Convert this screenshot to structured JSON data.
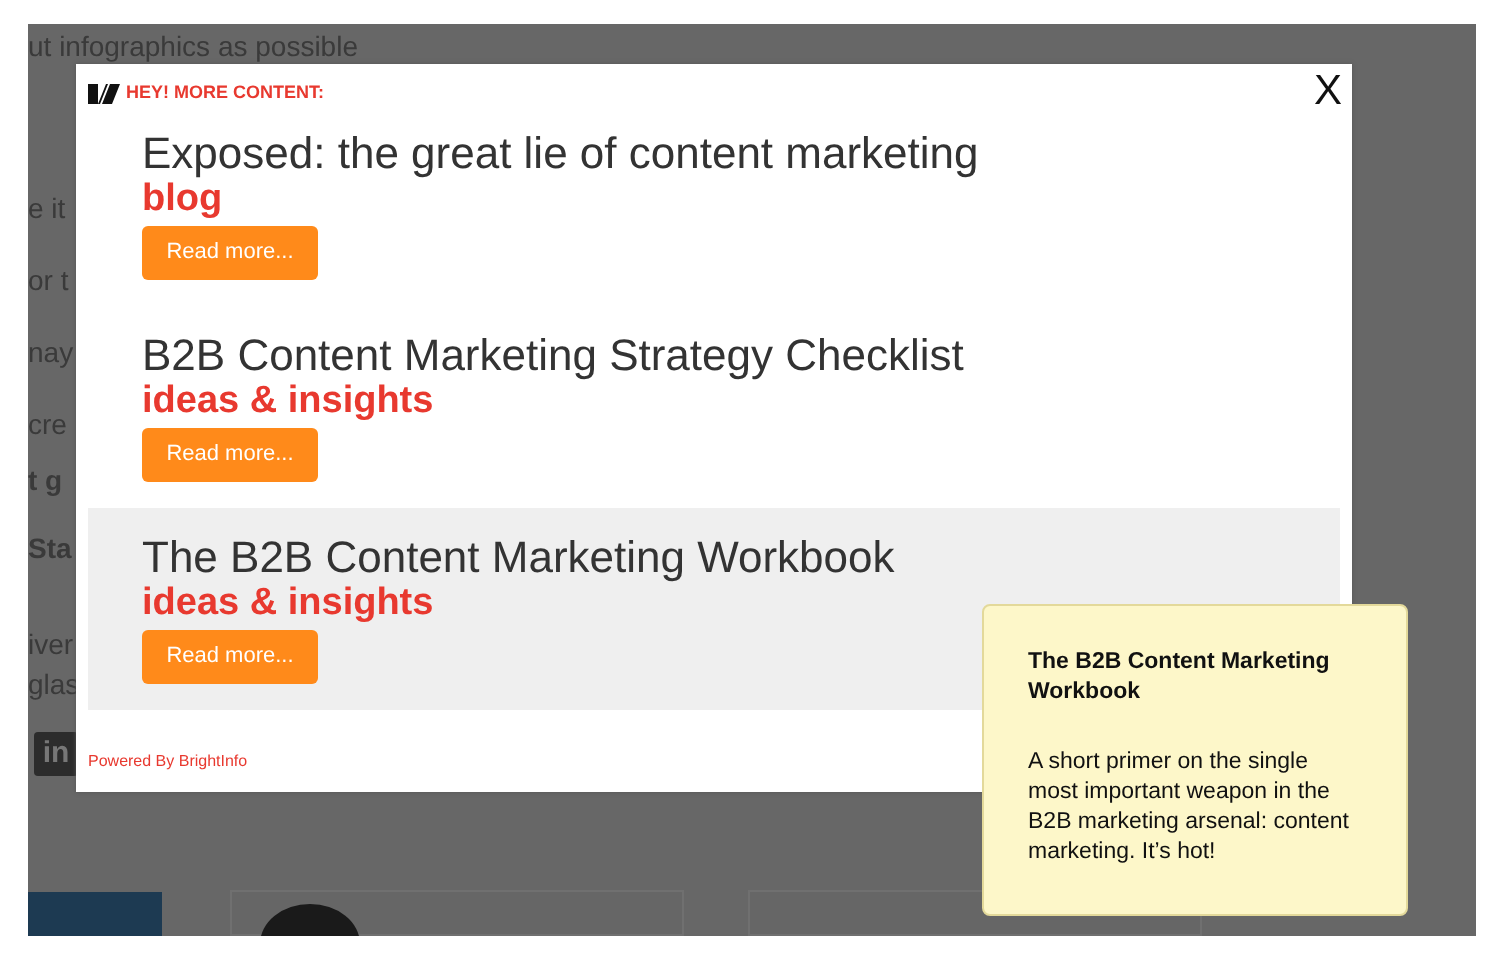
{
  "background_page": {
    "top_line": "ut infographics as possible",
    "fragments": [
      {
        "text": "e it",
        "bold": false
      },
      {
        "text": "or t",
        "bold": false
      },
      {
        "text": "nay",
        "bold": false
      },
      {
        "text": "cre",
        "bold": false
      },
      {
        "text": "t g",
        "bold": true
      },
      {
        "text": "Sta",
        "bold": true
      },
      {
        "text": "iver",
        "bold": false
      },
      {
        "text": "glas",
        "bold": false
      }
    ],
    "social_icon": "in"
  },
  "modal": {
    "header": "HEY! MORE CONTENT:",
    "close": "X",
    "items": [
      {
        "title": "Exposed: the great lie of content marketing",
        "category": "blog",
        "button": "Read more...",
        "hovered": false
      },
      {
        "title": "B2B Content Marketing Strategy Checklist",
        "category": "ideas & insights",
        "button": "Read more...",
        "hovered": false
      },
      {
        "title": "The B2B Content Marketing Workbook",
        "category": "ideas & insights",
        "button": "Read more...",
        "hovered": true
      }
    ],
    "footer": "Powered By BrightInfo"
  },
  "tooltip": {
    "title": "The B2B Content Marketing Workbook",
    "text": "A short primer on the single most important weapon in the B2B marketing arsenal: content marketing. It’s hot!"
  }
}
